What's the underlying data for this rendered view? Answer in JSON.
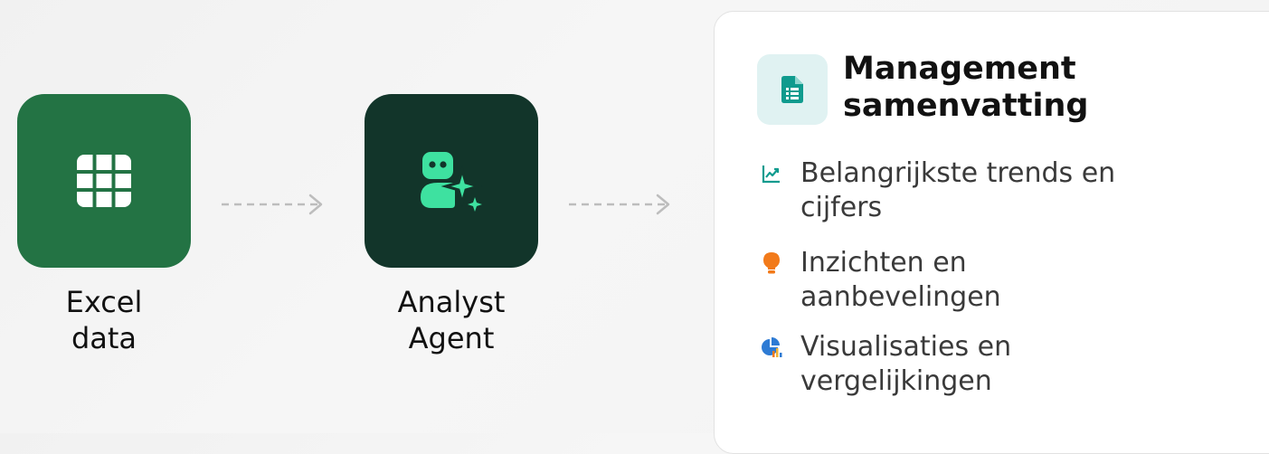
{
  "colors": {
    "excel_green": "#237344",
    "agent_dark": "#12352a",
    "agent_accent": "#3ee1a0",
    "doc_tile_bg": "#e0f2f2",
    "doc_icon": "#0f9b8e",
    "trend_icon": "#0f9b8e",
    "bulb_icon": "#f27a1a",
    "chart_icon": "#2e7bd4",
    "arrow": "#bdbdbd"
  },
  "steps": [
    {
      "icon": "grid-icon",
      "label_lines": [
        "Excel",
        "data"
      ]
    },
    {
      "icon": "robot-sparkle-icon",
      "label_lines": [
        "Analyst",
        "Agent"
      ]
    }
  ],
  "summary": {
    "icon": "document-icon",
    "title_lines": [
      "Management",
      "samenvatting"
    ],
    "bullets": [
      {
        "icon": "trend-chart-icon",
        "lines": [
          "Belangrijkste trends en",
          "cijfers"
        ]
      },
      {
        "icon": "lightbulb-icon",
        "lines": [
          "Inzichten en",
          "aanbevelingen"
        ]
      },
      {
        "icon": "pie-chart-icon",
        "lines": [
          "Visualisaties en",
          "vergelijkingen"
        ]
      }
    ]
  }
}
